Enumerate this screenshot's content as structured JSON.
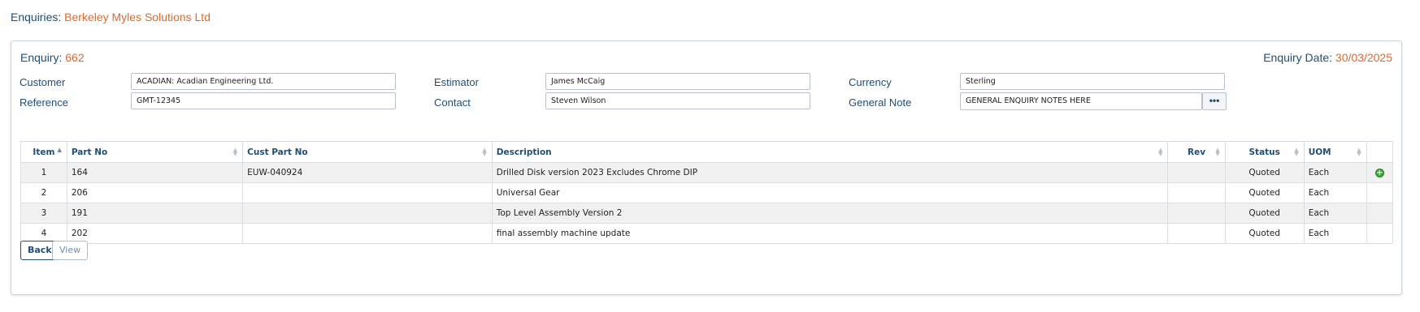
{
  "header": {
    "label": "Enquiries:",
    "org": "Berkeley Myles Solutions Ltd"
  },
  "enquiry": {
    "label": "Enquiry:",
    "number": "662",
    "date_label": "Enquiry Date:",
    "date": "30/03/2025"
  },
  "form": {
    "customer_label": "Customer",
    "customer_value": "ACADIAN: Acadian Engineering Ltd.",
    "reference_label": "Reference",
    "reference_value": "GMT-12345",
    "estimator_label": "Estimator",
    "estimator_value": "James McCaig",
    "contact_label": "Contact",
    "contact_value": "Steven Wilson",
    "currency_label": "Currency",
    "currency_value": "Sterling",
    "note_label": "General Note",
    "note_value": "GENERAL ENQUIRY NOTES HERE",
    "note_button": "•••"
  },
  "table": {
    "columns": [
      "Item",
      "Part No",
      "Cust Part No",
      "Description",
      "Rev",
      "Status",
      "UOM"
    ],
    "rows": [
      {
        "item": "1",
        "part_no": "164",
        "cust_part_no": "EUW-040924",
        "description": "Drilled Disk version 2023 Excludes Chrome DIP",
        "rev": "",
        "status": "Quoted",
        "uom": "Each",
        "add": "+"
      },
      {
        "item": "2",
        "part_no": "206",
        "cust_part_no": "",
        "description": "Universal Gear",
        "rev": "",
        "status": "Quoted",
        "uom": "Each"
      },
      {
        "item": "3",
        "part_no": "191",
        "cust_part_no": "",
        "description": "Top Level Assembly Version 2",
        "rev": "",
        "status": "Quoted",
        "uom": "Each"
      },
      {
        "item": "4",
        "part_no": "202",
        "cust_part_no": "",
        "description": "final assembly machine update",
        "rev": "",
        "status": "Quoted",
        "uom": "Each"
      }
    ]
  },
  "buttons": {
    "back": "Back",
    "view": "View"
  }
}
